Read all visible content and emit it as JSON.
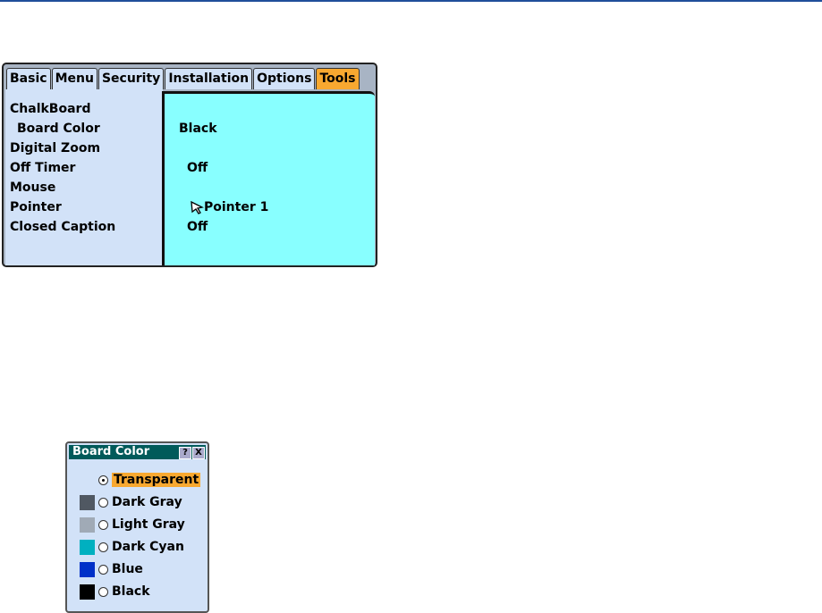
{
  "menu": {
    "tabs": [
      "Basic",
      "Menu",
      "Security",
      "Installation",
      "Options",
      "Tools"
    ],
    "active_tab": "Tools",
    "items": [
      "ChalkBoard",
      " Board Color",
      "Digital Zoom",
      "Off Timer",
      "Mouse",
      "Pointer",
      "Closed Caption"
    ],
    "values": {
      "board_color": "Black",
      "off_timer": "Off",
      "pointer": "Pointer 1",
      "closed_caption": "Off"
    }
  },
  "dialog": {
    "title": "Board Color",
    "help": "?",
    "close": "X",
    "options": [
      {
        "label": "Transparent",
        "color": null,
        "selected": true
      },
      {
        "label": "Dark Gray",
        "color": "#505862",
        "selected": false
      },
      {
        "label": "Light Gray",
        "color": "#a0aab6",
        "selected": false
      },
      {
        "label": "Dark Cyan",
        "color": "#00b0c0",
        "selected": false
      },
      {
        "label": "Blue",
        "color": "#0030c8",
        "selected": false
      },
      {
        "label": "Black",
        "color": "#000000",
        "selected": false
      }
    ]
  }
}
